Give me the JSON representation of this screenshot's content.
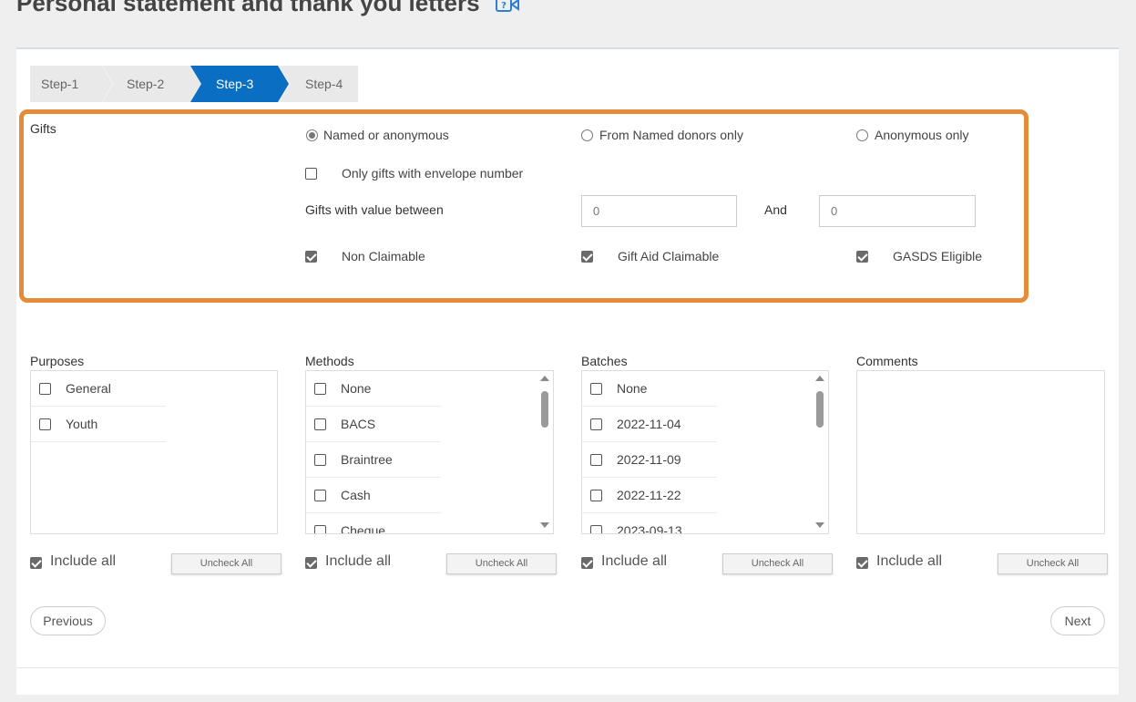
{
  "page": {
    "title": "Personal statement and thank you letters",
    "help_icon": "video-help-icon"
  },
  "steps": [
    "Step-1",
    "Step-2",
    "Step-3",
    "Step-4"
  ],
  "active_step": "Step-3",
  "gifts": {
    "section_label": "Gifts",
    "donor_filter": {
      "options": [
        "Named or anonymous",
        "From Named donors only",
        "Anonymous only"
      ],
      "selected": "Named or anonymous"
    },
    "envelope_only": {
      "label": "Only gifts with envelope number",
      "checked": false
    },
    "value_range": {
      "label": "Gifts with value between",
      "and_label": "And",
      "min": "0",
      "max": "0"
    },
    "claim_types": [
      {
        "label": "Non Claimable",
        "checked": true
      },
      {
        "label": "Gift Aid Claimable",
        "checked": true
      },
      {
        "label": "GASDS Eligible",
        "checked": true
      }
    ]
  },
  "columns": {
    "purposes": {
      "title": "Purposes",
      "items": [
        "General",
        "Youth"
      ]
    },
    "methods": {
      "title": "Methods",
      "items": [
        "None",
        "BACS",
        "Braintree",
        "Cash",
        "Cheque"
      ]
    },
    "batches": {
      "title": "Batches",
      "items": [
        "None",
        "2022-11-04",
        "2022-11-09",
        "2022-11-22",
        "2023-09-13"
      ]
    },
    "comments": {
      "title": "Comments",
      "items": []
    }
  },
  "include_all_label": "Include all",
  "uncheck_all_label": "Uncheck All",
  "nav": {
    "previous": "Previous",
    "next": "Next"
  },
  "colors": {
    "accent_blue": "#0a6fc2",
    "highlight_orange": "#e58c3a"
  }
}
